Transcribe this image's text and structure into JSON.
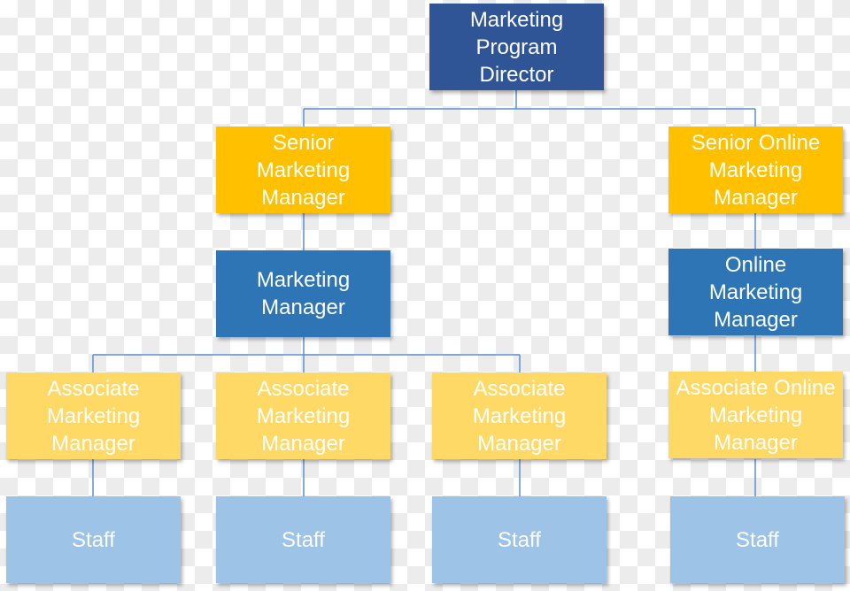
{
  "colors": {
    "director": "#2f5597",
    "senior": "#ffc000",
    "manager": "#2e75b6",
    "associate": "#ffd966",
    "staff": "#9dc3e6",
    "connector": "#5b8fd0"
  },
  "nodes": {
    "director": "Marketing\nProgram\nDirector",
    "senior_mm": "Senior\nMarketing\nManager",
    "senior_online": "Senior Online\nMarketing\nManager",
    "mm": "Marketing\nManager",
    "online_mm": "Online\nMarketing\nManager",
    "assoc_1": "Associate\nMarketing\nManager",
    "assoc_2": "Associate\nMarketing\nManager",
    "assoc_3": "Associate\nMarketing\nManager",
    "assoc_online": "Associate Online\nMarketing\nManager",
    "staff_1": "Staff",
    "staff_2": "Staff",
    "staff_3": "Staff",
    "staff_4": "Staff"
  }
}
